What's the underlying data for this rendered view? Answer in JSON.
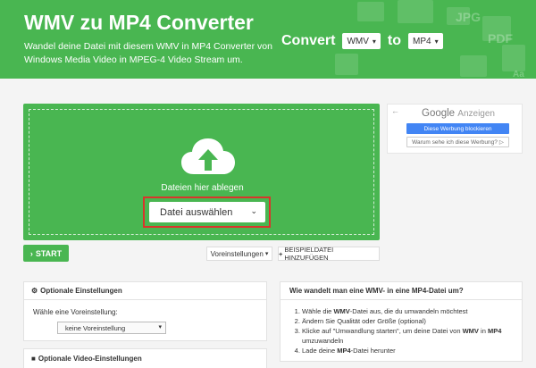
{
  "header": {
    "title": "WMV zu MP4 Converter",
    "subtitle": "Wandel deine Datei mit diesem WMV in MP4 Converter von Windows Media Video in MPEG-4 Video Stream um.",
    "convert_label": "Convert",
    "from_format": "WMV",
    "to_label": "to",
    "to_format": "MP4",
    "bg_color": "#49b651",
    "deco_labels": [
      "JPG",
      "PDF",
      "Aa"
    ]
  },
  "upload": {
    "drop_label": "Dateien hier ablegen",
    "choose_button": "Datei auswählen",
    "icon": "cloud-upload-icon"
  },
  "toolbar": {
    "start_label": "START",
    "presets_label": "Voreinstellungen",
    "sample_label": "BEISPIELDATEI HINZUFÜGEN"
  },
  "ad": {
    "google": "Google",
    "anzeigen": "Anzeigen",
    "block_button": "Diese Werbung blockieren",
    "why_button": "Warum sehe ich diese Werbung?"
  },
  "options": {
    "title": "Optionale Einstellungen",
    "preset_label": "Wähle eine Voreinstellung:",
    "preset_value": "keine Voreinstellung",
    "video_title": "Optionale Video-Einstellungen"
  },
  "help": {
    "title": "Wie wandelt man eine WMV- in eine MP4-Datei um?",
    "steps": [
      {
        "pre": "Wähle die ",
        "bold": "WMV",
        "post": "-Datei aus, die du umwandeln möchtest"
      },
      {
        "pre": "Ändern Sie Qualität oder Größe (optional)",
        "bold": "",
        "post": ""
      },
      {
        "pre": "Klicke auf \"Umwandlung starten\", um deine Datei von ",
        "bold": "WMV",
        "mid": " in ",
        "bold2": "MP4",
        "post": " umzuwandeln"
      },
      {
        "pre": "Lade deine ",
        "bold": "MP4",
        "post": "-Datei herunter"
      }
    ]
  }
}
